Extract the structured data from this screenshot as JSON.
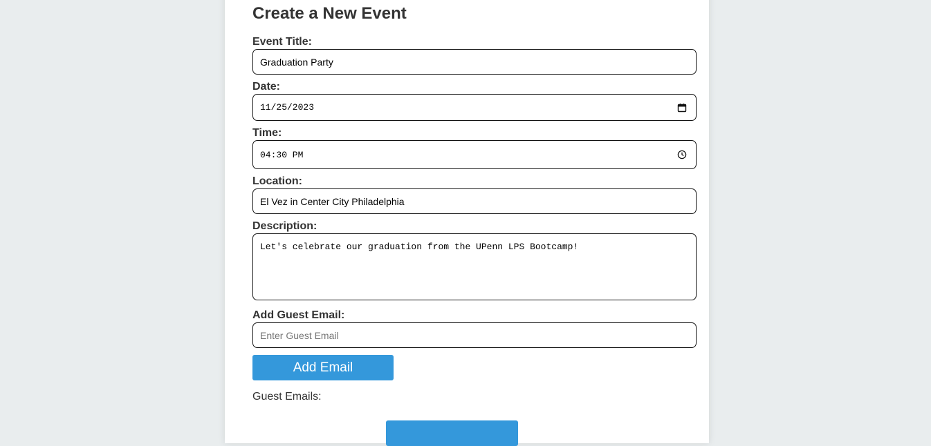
{
  "form": {
    "title": "Create a New Event",
    "event_title": {
      "label": "Event Title:",
      "value": "Graduation Party"
    },
    "date": {
      "label": "Date:",
      "value": "11/25/2023",
      "icon": "calendar-icon"
    },
    "time": {
      "label": "Time:",
      "value": "04:30 PM",
      "icon": "clock-icon"
    },
    "location": {
      "label": "Location:",
      "value": "El Vez in Center City Philadelphia"
    },
    "description": {
      "label": "Description:",
      "value": "Let's celebrate our graduation from the UPenn LPS Bootcamp!"
    },
    "guest_email": {
      "label": "Add Guest Email:",
      "placeholder": "Enter Guest Email",
      "value": ""
    },
    "add_email_button": "Add Email",
    "guest_emails_label": "Guest Emails:"
  },
  "colors": {
    "page_background": "#e9edee",
    "card_background": "#ffffff",
    "button_blue": "#3498db",
    "text": "#333333"
  }
}
